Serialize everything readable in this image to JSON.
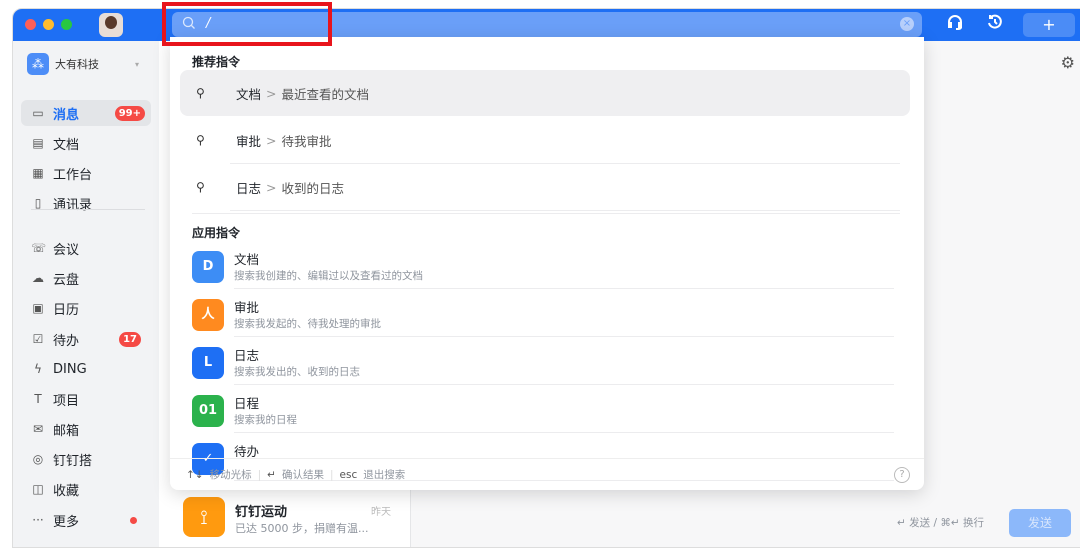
{
  "colors": {
    "accent": "#1e6ff4",
    "badge": "#f54a45",
    "highlight": "#e8141c"
  },
  "search": {
    "value": "/",
    "icon": "search-icon"
  },
  "org": {
    "name": "大有科技"
  },
  "sidebar": {
    "items": [
      {
        "label": "消息",
        "icon": "message-icon",
        "badge": "99+"
      },
      {
        "label": "文档",
        "icon": "doc-icon"
      },
      {
        "label": "工作台",
        "icon": "grid-icon"
      },
      {
        "label": "通讯录",
        "icon": "contacts-icon"
      },
      {
        "label": "会议",
        "icon": "phone-icon"
      },
      {
        "label": "云盘",
        "icon": "cloud-icon"
      },
      {
        "label": "日历",
        "icon": "calendar-icon"
      },
      {
        "label": "待办",
        "icon": "todo-icon",
        "badge": "17"
      },
      {
        "label": "DING",
        "icon": "ding-icon"
      },
      {
        "label": "项目",
        "icon": "project-icon"
      },
      {
        "label": "邮箱",
        "icon": "mail-icon"
      },
      {
        "label": "钉钉搭",
        "icon": "builder-icon"
      },
      {
        "label": "收藏",
        "icon": "star-icon"
      },
      {
        "label": "更多",
        "icon": "more-icon",
        "dot": true
      }
    ]
  },
  "dropdown": {
    "recommended_title": "推荐指令",
    "recommended": [
      {
        "name": "文档",
        "sub": "最近查看的文档"
      },
      {
        "name": "审批",
        "sub": "待我审批"
      },
      {
        "name": "日志",
        "sub": "收到的日志"
      }
    ],
    "apps_title": "应用指令",
    "apps": [
      {
        "name": "文档",
        "desc": "搜索我创建的、编辑过以及查看过的文档",
        "color": "#3d8df5",
        "glyph": "D"
      },
      {
        "name": "审批",
        "desc": "搜索我发起的、待我处理的审批",
        "color": "#ff8a1f",
        "glyph": "人"
      },
      {
        "name": "日志",
        "desc": "搜索我发出的、收到的日志",
        "color": "#1e6ff4",
        "glyph": "L"
      },
      {
        "name": "日程",
        "desc": "搜索我的日程",
        "color": "#2bb24c",
        "glyph": "01"
      },
      {
        "name": "待办",
        "desc": "",
        "color": "#1e6ff4",
        "glyph": "✓"
      }
    ],
    "footer": {
      "move": "移动光标",
      "confirm": "确认结果",
      "esc": "esc",
      "exit": "退出搜索",
      "move_key": "↑↓",
      "confirm_key": "↵"
    }
  },
  "chat": {
    "name": "钉钉运动",
    "time": "昨天",
    "preview": "已达 5000 步，捐赠有温..."
  },
  "composer": {
    "hint": "↵ 发送 / ⌘↵ 换行",
    "send": "发送"
  }
}
